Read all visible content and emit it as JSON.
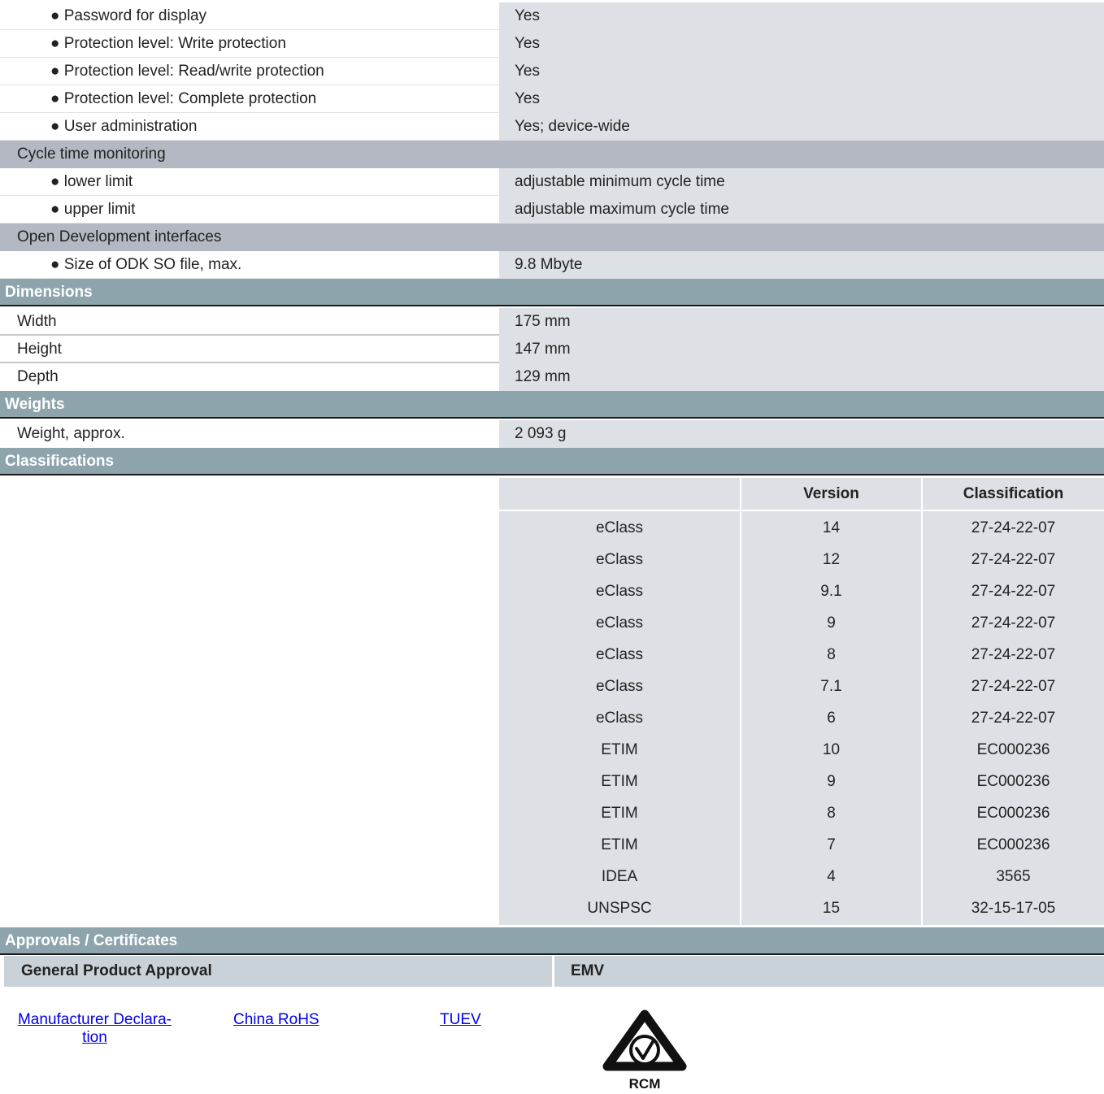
{
  "security_rows": [
    {
      "label": "● Password for display",
      "value": "Yes"
    },
    {
      "label": "● Protection level: Write protection",
      "value": "Yes"
    },
    {
      "label": "● Protection level: Read/write protection",
      "value": "Yes"
    },
    {
      "label": "● Protection level: Complete protection",
      "value": "Yes"
    },
    {
      "label": "● User administration",
      "value": "Yes; device-wide"
    }
  ],
  "cycle": {
    "group_label": "Cycle time monitoring",
    "rows": [
      {
        "label": "● lower limit",
        "value": "adjustable minimum cycle time"
      },
      {
        "label": "● upper limit",
        "value": "adjustable maximum cycle time"
      }
    ]
  },
  "odk": {
    "group_label": "Open Development interfaces",
    "rows": [
      {
        "label": "● Size of ODK SO file, max.",
        "value": "9.8 Mbyte"
      }
    ]
  },
  "dimensions": {
    "title": "Dimensions",
    "rows": [
      {
        "label": "Width",
        "value": "175 mm"
      },
      {
        "label": "Height",
        "value": "147 mm"
      },
      {
        "label": "Depth",
        "value": "129 mm"
      }
    ]
  },
  "weights": {
    "title": "Weights",
    "rows": [
      {
        "label": "Weight, approx.",
        "value": "2 093 g"
      }
    ]
  },
  "classifications": {
    "title": "Classifications",
    "headers": [
      "",
      "Version",
      "Classification"
    ],
    "rows": [
      [
        "eClass",
        "14",
        "27-24-22-07"
      ],
      [
        "eClass",
        "12",
        "27-24-22-07"
      ],
      [
        "eClass",
        "9.1",
        "27-24-22-07"
      ],
      [
        "eClass",
        "9",
        "27-24-22-07"
      ],
      [
        "eClass",
        "8",
        "27-24-22-07"
      ],
      [
        "eClass",
        "7.1",
        "27-24-22-07"
      ],
      [
        "eClass",
        "6",
        "27-24-22-07"
      ],
      [
        "ETIM",
        "10",
        "EC000236"
      ],
      [
        "ETIM",
        "9",
        "EC000236"
      ],
      [
        "ETIM",
        "8",
        "EC000236"
      ],
      [
        "ETIM",
        "7",
        "EC000236"
      ],
      [
        "IDEA",
        "4",
        "3565"
      ],
      [
        "UNSPSC",
        "15",
        "32-15-17-05"
      ]
    ]
  },
  "approvals": {
    "title": "Approvals / Certificates",
    "general_label": "General Product Approval",
    "emv_label": "EMV",
    "links": {
      "manufacturer_line1": "Manufacturer Declara-",
      "manufacturer_line2": "tion",
      "china_rohs": "China RoHS",
      "tuev": "TUEV"
    },
    "rcm_logo_text": "RCM"
  }
}
